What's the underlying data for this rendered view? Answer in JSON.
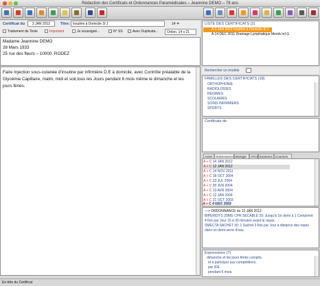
{
  "window": {
    "title": "Rédaction des Certificats et Ordonnances Paramédicales – Jeannine DEMO – 78 ans"
  },
  "form": {
    "date_label": "Certificat du",
    "date_value": "3 JAN 2012",
    "title_label": "Titre:",
    "title_value": "Insuline à Domicile 3/ J",
    "page_indicator": "14 ≑"
  },
  "options": {
    "texte": "Traitement de Texte",
    "important": "Important",
    "soussigne": "Je soussigné...",
    "ns": "N° SS",
    "duplicata": "Avec Duplicata...",
    "ordon": "Ordon. 14 x 21"
  },
  "patient": [
    "Madame Jeannine DEMO",
    "28 Mars 1933",
    "25 rue des fleurs – 10000. RODEZ"
  ],
  "body_text": "Faire Injection sous-cutanée d'insuline par infirmière D.E à domicile, avec Contrôle préalable de la Glycémie Capillaire, matin, midi et soir,tous les Jours pendant 6 mois même le dimanche et les jours fériés.",
  "certificats_list": {
    "header": "LISTE DES CERTIFICATS (2)",
    "items": [
      {
        "text": "A  3 JAN 2012 Insuline à Domicile 3/ J",
        "selected": true
      },
      {
        "text": "A  14 DEC 2011 Drainage Lymphatique  Memb Inf G",
        "selected": false
      }
    ]
  },
  "search": {
    "label": "Rechercher un modèle"
  },
  "familles": {
    "header": "FAMILLES DES CERTIFICATS (18)",
    "items": [
      "ORTHOPHONIE",
      "RADIOLOGIES",
      "REGIMES",
      "SCOLAIRES",
      "SOINS INFIRMIERS",
      "SPORTS"
    ]
  },
  "certificats_de": {
    "header": "Certificats de"
  },
  "tabs": [
    "Actes",
    "Ordonnances",
    "Biologie",
    "ATCD",
    "Examens",
    "Courriers"
  ],
  "dated_list": {
    "rows": [
      {
        "mark": "A + C",
        "date": "14 JAN 2012",
        "highlight": false
      },
      {
        "mark": "A + C",
        "date": "12 JAN 2012",
        "highlight": true
      },
      {
        "mark": "A + C",
        "date": "14 NOV 2011",
        "highlight": false
      },
      {
        "mark": "A + C",
        "date": "18 OCT 2004",
        "highlight": false
      },
      {
        "mark": "A + C",
        "date": "22 JUL 2004",
        "highlight": false
      },
      {
        "mark": "A + V",
        "date": "28 JUN 2004",
        "highlight": false
      },
      {
        "mark": "A + C",
        "date": "13 AVR 2004",
        "highlight": false
      },
      {
        "mark": "A + C",
        "date": "12 JAN 2004",
        "highlight": false
      },
      {
        "mark": "A + C",
        "date": "21 OCT 2003",
        "highlight": false
      },
      {
        "mark": "A + C",
        "date": "8 OCT 2003",
        "highlight": false
      },
      {
        "mark": "A + C",
        "date": "4 MAR 2003",
        "highlight": false
      }
    ]
  },
  "ordonnance_preview": [
    "---> ORDONNANCE du 12 JAN 2012:",
    "BIPERIDYS 20MG CPR SECABLE 20: Jusqu'à 1in demi à 1 Comprimé",
    "4 fois par Jour 15 à 30 minutes avant le repas.",
    "SMECTA SACHET 30: 1 Sachet 3 fois par Jour à distance des repas",
    "dans un demi-verre d'eau."
  ],
  "expressions": {
    "header": "Expressions (7)",
    "items": [
      "dimanche et les jours fériés compris.",
      "et à participer aux compétitions.",
      "par IDE",
      "pendant 6 mois."
    ]
  },
  "statusbar": {
    "text": "En-tête du Certificat"
  },
  "colors": {
    "accent": "#f39a1c",
    "link": "#2c4c8c",
    "selection": "#3a74d8"
  }
}
